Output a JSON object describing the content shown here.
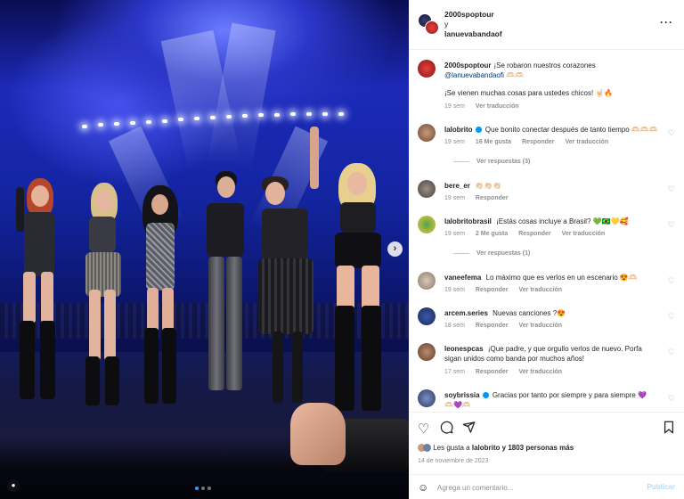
{
  "post": {
    "photo_alt": "",
    "carousel": {
      "count": 3,
      "active": 0
    },
    "next_icon": "chevron-right-icon",
    "tagged_icon": "user-tag-icon"
  },
  "header": {
    "user1": "2000spoptour",
    "connector": "y",
    "user2": "lanuevabandaof",
    "more_icon": "more-horizontal-icon"
  },
  "caption": {
    "user": "2000spoptour",
    "text": "¡Se robaron nuestros corazones",
    "mention": "@lanuevabandaofi",
    "emoji": "🫶🏻🫶🏻",
    "line2": "¡Se vienen muchas cosas para ustedes chicos! 🤘🏻🔥",
    "time": "19 sem",
    "translate": "Ver traducción"
  },
  "comments": [
    {
      "user": "lalobrito",
      "verified": true,
      "text": "Que bonito conectar después de tanto tiempo 🫶🏻🫶🏻🫶🏻",
      "time": "19 sem",
      "likes": "16 Me gusta",
      "reply": "Responder",
      "translate": "Ver traducción",
      "replies": "Ver respuestas (3)"
    },
    {
      "user": "bere_er",
      "verified": false,
      "text": "👏🏻👏🏻👏🏻",
      "time": "19 sem",
      "reply": "Responder"
    },
    {
      "user": "lalobritobrasil",
      "verified": false,
      "text": "¡Estás cosas incluye a Brasil? 💚🇧🇷💛🥰",
      "time": "19 sem",
      "likes": "2 Me gusta",
      "reply": "Responder",
      "translate": "Ver traducción",
      "replies": "Ver respuestas (1)"
    },
    {
      "user": "vaneefema",
      "verified": false,
      "text": "Lo máximo que es verlos en un escenario 😍🫶🏻",
      "time": "19 sem",
      "reply": "Responder",
      "translate": "Ver traducción"
    },
    {
      "user": "arcem.series",
      "verified": false,
      "text": "Nuevas canciones ?😍",
      "time": "18 sem",
      "reply": "Responder",
      "translate": "Ver traducción"
    },
    {
      "user": "leonespcas",
      "verified": false,
      "text": "¡Que padre, y que orgullo verlos de nuevo. Porfa sigan unidos como banda por muchos años!",
      "time": "17 sem",
      "reply": "Responder",
      "translate": "Ver traducción"
    },
    {
      "user": "soybrissia",
      "verified": true,
      "text": "Gracias por tanto por siempre y para siempre 💜",
      "text2": "🫶🏻💜🫶🏻",
      "time": "",
      "reply": ""
    }
  ],
  "actions": {
    "like_icon": "heart-icon",
    "comment_icon": "comment-icon",
    "share_icon": "send-icon",
    "save_icon": "bookmark-icon",
    "likes_prefix": "Les gusta a",
    "likes_user": "lalobrito",
    "likes_suffix": "y 1803 personas más",
    "date": "14 de noviembre de 2023"
  },
  "composer": {
    "emoji_icon": "smiley-icon",
    "placeholder": "Agrega un comentario...",
    "publish": "Publicar"
  },
  "colors": {
    "link": "#00376b",
    "verified": "#0095f6",
    "meta": "#8e8e8e",
    "publish_disabled": "#b3dbff",
    "stage_blue": "#1c2ab8"
  }
}
